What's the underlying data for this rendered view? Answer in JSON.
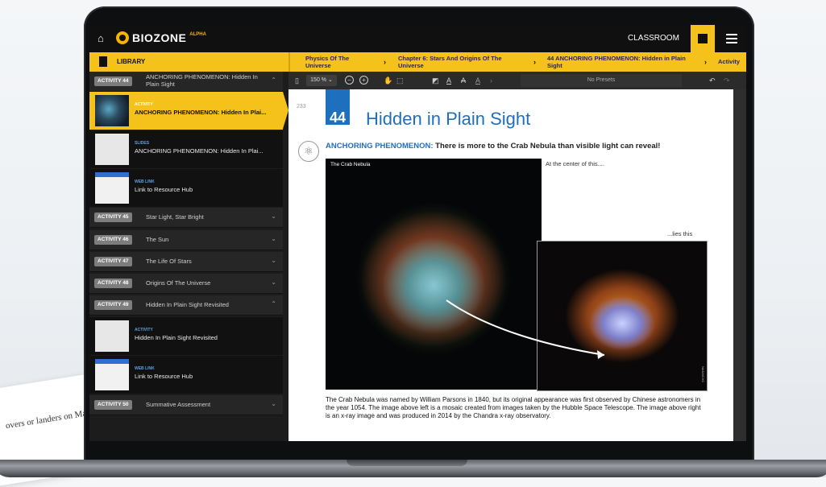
{
  "background": {
    "paper_text": "overs or landers on Ma"
  },
  "topbar": {
    "logo_text": "BIOZONE",
    "logo_sup": "ALPHA",
    "classroom_label": "CLASSROOM"
  },
  "breadcrumb": {
    "library_label": "LIBRARY",
    "items": [
      "Physics Of The Universe",
      "Chapter 6: Stars And Origins Of The Universe",
      "44 ANCHORING PHENOMENON: Hidden in Plain Sight",
      "Activity"
    ]
  },
  "sidebar": {
    "activity44": {
      "badge": "ACTIVITY 44",
      "title": "ANCHORING PHENOMENON: Hidden In Plain Sight"
    },
    "resources44": [
      {
        "type": "ACTIVITY",
        "title": "ANCHORING PHENOMENON: Hidden In Plai..."
      },
      {
        "type": "SLIDES",
        "title": "ANCHORING PHENOMENON: Hidden In Plai..."
      },
      {
        "type": "WEB LINK",
        "title": "Link to Resource Hub"
      }
    ],
    "activities": [
      {
        "badge": "ACTIVITY 45",
        "title": "Star Light, Star Bright"
      },
      {
        "badge": "ACTIVITY 46",
        "title": "The Sun"
      },
      {
        "badge": "ACTIVITY 47",
        "title": "The Life Of Stars"
      },
      {
        "badge": "ACTIVITY 48",
        "title": "Origins Of The Universe"
      },
      {
        "badge": "ACTIVITY 49",
        "title": "Hidden In Plain Sight Revisited"
      }
    ],
    "resources49": [
      {
        "type": "ACTIVITY",
        "title": "Hidden In Plain Sight Revisited"
      },
      {
        "type": "WEB LINK",
        "title": "Link to Resource Hub"
      }
    ],
    "activity50": {
      "badge": "ACTIVITY 50",
      "title": "Summative Assessment"
    }
  },
  "toolbar": {
    "zoom": "150 % ⌄",
    "presets": "No Presets"
  },
  "document": {
    "page_number": "233",
    "activity_number": "44",
    "heading": "Hidden in Plain Sight",
    "phenomenon_label": "ANCHORING PHENOMENON:",
    "phenomenon_text": " There is more to the Crab Nebula than visible light can reveal!",
    "image_label": "The Crab Nebula",
    "text_center": "At the center of this....",
    "text_lies": "...lies this",
    "inset_credit": "NASA/CXC",
    "caption": "The Crab Nebula was named by William Parsons in 1840, but its original appearance was first observed by Chinese astronomers in the year 1054. The image above left is a mosaic created from images taken by the Hubble Space Telescope. The image above right is an x-ray image and was produced in 2014 by the Chandra x-ray observatory."
  },
  "colors": {
    "accent_yellow": "#f5c21b",
    "accent_blue": "#1f6fbf"
  }
}
